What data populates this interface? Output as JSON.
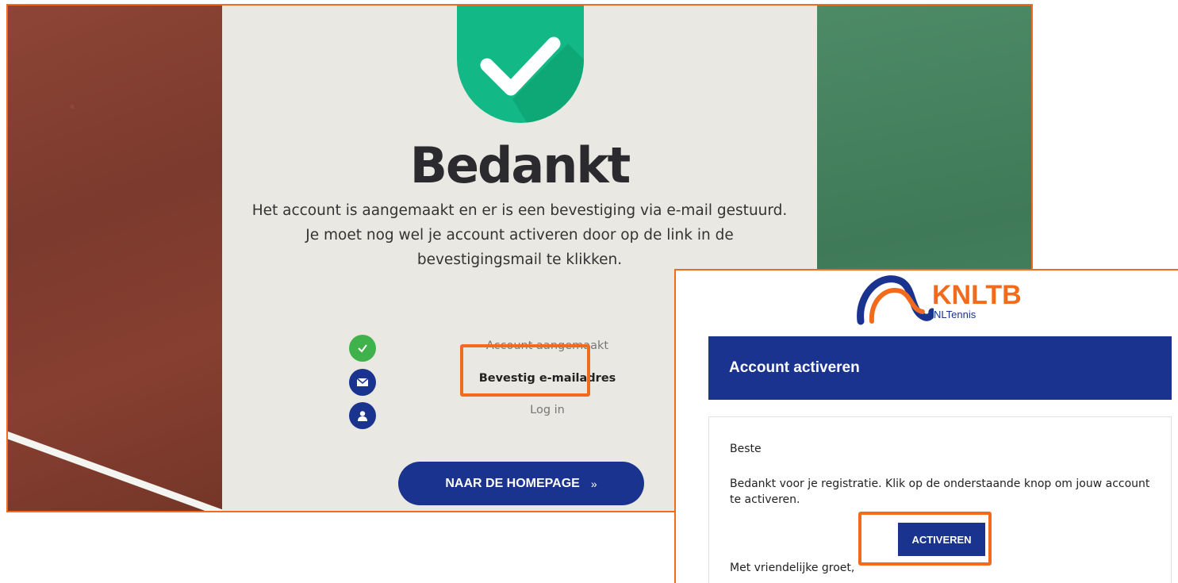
{
  "thank_you": {
    "title": "Bedankt",
    "description": "Het account is aangemaakt en er is een bevestiging via e-mail gestuurd. Je moet nog wel je account activeren door op de link in de bevestigingsmail te klikken.",
    "steps": [
      {
        "label": "Account aangemaakt",
        "icon": "check-icon",
        "color": "#3fb24b",
        "state": "done"
      },
      {
        "label": "Bevestig e-mailadres",
        "icon": "envelope-icon",
        "color": "#1a338f",
        "state": "current"
      },
      {
        "label": "Log in",
        "icon": "user-icon",
        "color": "#1a338f",
        "state": "pending"
      }
    ],
    "home_button": "NAAR DE HOMEPAGE",
    "home_button_chevron": "»"
  },
  "email": {
    "logo_text": "KNLTB",
    "logo_sub": "NLTennis",
    "header_title": "Account activeren",
    "greeting": "Beste",
    "body": "Bedankt voor je registratie. Klik op de onderstaande knop om jouw account te activeren.",
    "activate_button": "ACTIVEREN",
    "closing": "Met vriendelijke groet,"
  },
  "colors": {
    "accent_orange": "#f26b1d",
    "brand_blue": "#1a338f",
    "success_green": "#12b886"
  }
}
